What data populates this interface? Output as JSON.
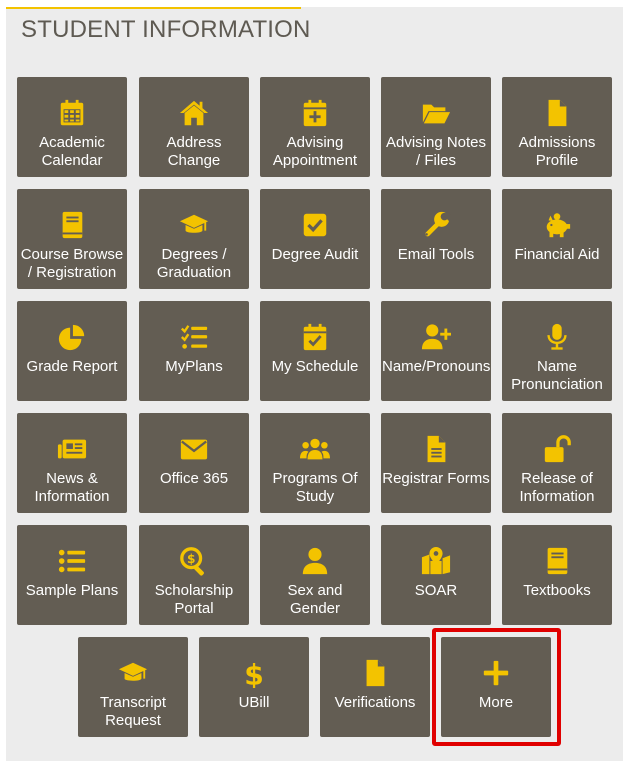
{
  "panel": {
    "title": "STUDENT INFORMATION"
  },
  "tiles": [
    {
      "label": "Academic Calendar",
      "icon": "calendar-icon"
    },
    {
      "label": "Address Change",
      "icon": "home-icon"
    },
    {
      "label": "Advising Appointment",
      "icon": "calendar-plus-icon"
    },
    {
      "label": "Advising Notes / Files",
      "icon": "folder-open-icon"
    },
    {
      "label": "Admissions Profile",
      "icon": "file-icon"
    },
    {
      "label": "Course Browse / Registration",
      "icon": "book-icon"
    },
    {
      "label": "Degrees / Graduation",
      "icon": "graduation-cap-icon"
    },
    {
      "label": "Degree Audit",
      "icon": "checkbox-icon"
    },
    {
      "label": "Email Tools",
      "icon": "wrench-icon"
    },
    {
      "label": "Financial Aid",
      "icon": "piggy-bank-icon"
    },
    {
      "label": "Grade Report",
      "icon": "pie-chart-icon"
    },
    {
      "label": "MyPlans",
      "icon": "checklist-icon"
    },
    {
      "label": "My Schedule",
      "icon": "calendar-check-icon"
    },
    {
      "label": "Name/Pronouns",
      "icon": "user-plus-icon"
    },
    {
      "label": "Name Pronunciation",
      "icon": "microphone-icon"
    },
    {
      "label": "News & Information",
      "icon": "newspaper-icon"
    },
    {
      "label": "Office 365",
      "icon": "envelope-icon"
    },
    {
      "label": "Programs Of Study",
      "icon": "users-icon"
    },
    {
      "label": "Registrar Forms",
      "icon": "file-lines-icon"
    },
    {
      "label": "Release of Information",
      "icon": "unlock-icon"
    },
    {
      "label": "Sample Plans",
      "icon": "list-icon"
    },
    {
      "label": "Scholarship Portal",
      "icon": "search-dollar-icon"
    },
    {
      "label": "Sex and Gender",
      "icon": "user-icon"
    },
    {
      "label": "SOAR",
      "icon": "map-pin-icon"
    },
    {
      "label": "Textbooks",
      "icon": "book-icon"
    },
    {
      "label": "Transcript Request",
      "icon": "graduation-cap-icon"
    },
    {
      "label": "UBill",
      "icon": "dollar-icon"
    },
    {
      "label": "Verifications",
      "icon": "file-icon"
    },
    {
      "label": "More",
      "icon": "plus-icon"
    }
  ],
  "colors": {
    "tile_bg": "#635d53",
    "icon": "#f3c300",
    "label": "#ffffff",
    "title": "#5e5a52",
    "panel_bg": "#ececec",
    "highlight": "#e00000"
  }
}
